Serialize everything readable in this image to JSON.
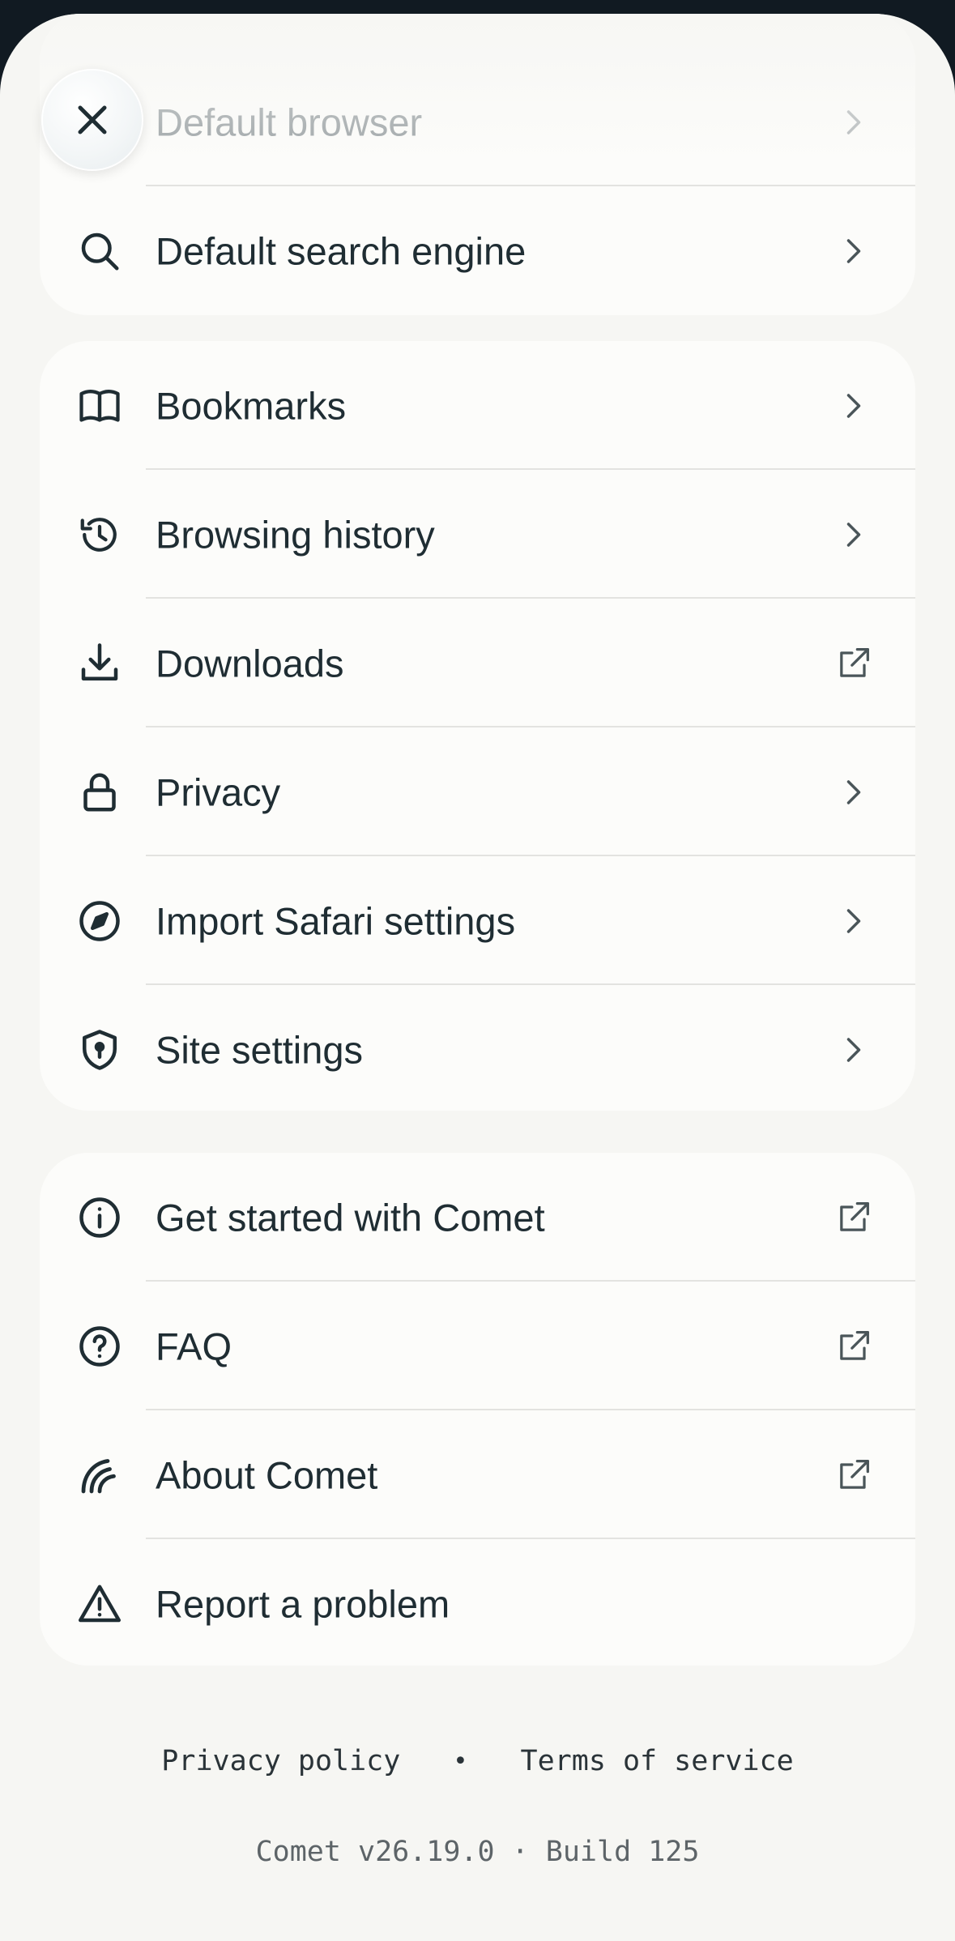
{
  "groups": [
    {
      "items": [
        {
          "label": "Default browser",
          "icon": "browser-icon",
          "trailing": "chevron-right-icon"
        },
        {
          "label": "Default search engine",
          "icon": "search-icon",
          "trailing": "chevron-right-icon"
        }
      ]
    },
    {
      "items": [
        {
          "label": "Bookmarks",
          "icon": "book-open-icon",
          "trailing": "chevron-right-icon"
        },
        {
          "label": "Browsing history",
          "icon": "history-icon",
          "trailing": "chevron-right-icon"
        },
        {
          "label": "Downloads",
          "icon": "download-icon",
          "trailing": "external-link-icon"
        },
        {
          "label": "Privacy",
          "icon": "lock-icon",
          "trailing": "chevron-right-icon"
        },
        {
          "label": "Import Safari settings",
          "icon": "compass-icon",
          "trailing": "chevron-right-icon"
        },
        {
          "label": "Site settings",
          "icon": "shield-icon",
          "trailing": "chevron-right-icon"
        }
      ]
    },
    {
      "items": [
        {
          "label": "Get started with Comet",
          "icon": "info-icon",
          "trailing": "external-link-icon"
        },
        {
          "label": "FAQ",
          "icon": "help-circle-icon",
          "trailing": "external-link-icon"
        },
        {
          "label": "About Comet",
          "icon": "comet-logo-icon",
          "trailing": "external-link-icon"
        },
        {
          "label": "Report a problem",
          "icon": "warning-triangle-icon",
          "trailing": ""
        }
      ]
    }
  ],
  "close_button": {
    "icon": "close-icon"
  },
  "footer": {
    "privacy_policy": "Privacy policy",
    "separator": "•",
    "terms_of_service": "Terms of service",
    "version": "Comet v26.19.0 · Build 125"
  },
  "colors": {
    "sheet_background": "#f6f6f3",
    "card_background": "#fcfcfa",
    "text": "#1f2d33",
    "divider": "#e3e3e0"
  }
}
